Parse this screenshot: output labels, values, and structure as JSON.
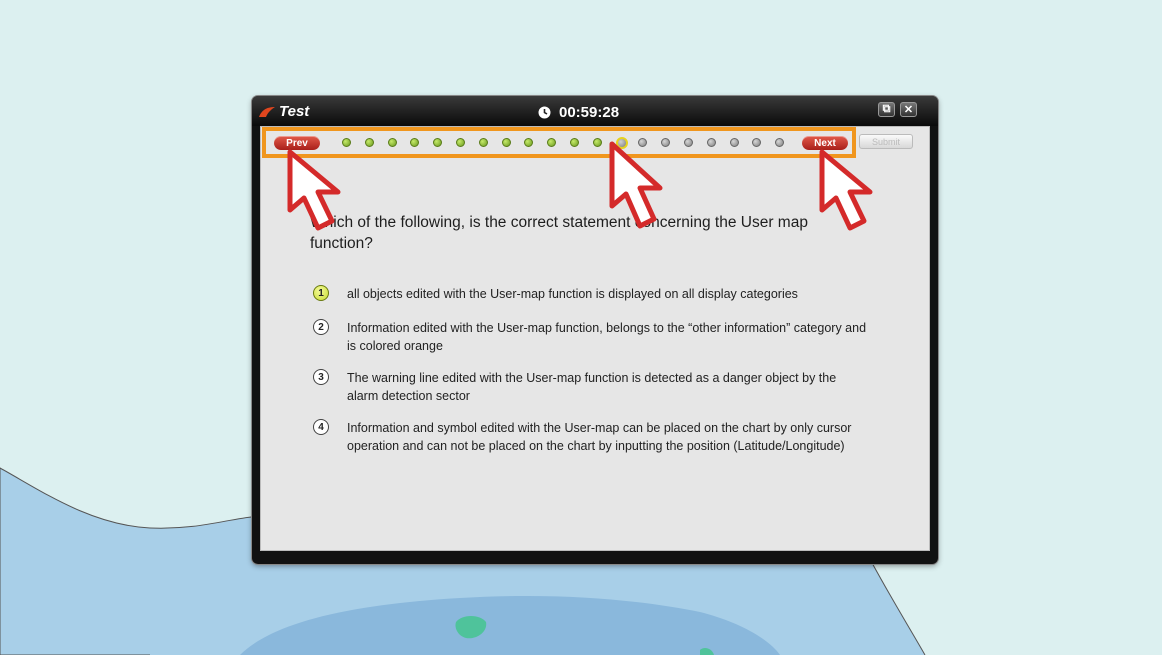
{
  "window": {
    "title": "Test",
    "timer": "00:59:28"
  },
  "nav": {
    "prev_label": "Prev",
    "next_label": "Next",
    "submit_label": "Submit",
    "question_dots": [
      "answered",
      "answered",
      "answered",
      "answered",
      "answered",
      "answered",
      "answered",
      "answered",
      "answered",
      "answered",
      "answered",
      "answered",
      "current",
      "pending",
      "pending",
      "pending",
      "pending",
      "pending",
      "pending",
      "pending"
    ]
  },
  "question": {
    "text": "Which of the following, is the correct statement concerning the User map function?"
  },
  "choices": [
    {
      "num": "1",
      "text": "all objects edited with the User-map function is displayed on all display categories",
      "selected": true
    },
    {
      "num": "2",
      "text": "Information edited with the User-map function, belongs to the “other information” category and is colored orange",
      "selected": false
    },
    {
      "num": "3",
      "text": "The warning line edited with the User-map function is detected as a danger object by the alarm detection sector",
      "selected": false
    },
    {
      "num": "4",
      "text": "Information and symbol edited with the User-map can be placed on the chart by only cursor operation and can not be placed on the chart by inputting the position (Latitude/Longitude)",
      "selected": false
    }
  ],
  "colors": {
    "highlight_border": "#f0961e",
    "pointer_fill": "#ffffff",
    "pointer_outline": "#d42a2a",
    "sea": "#a8cfe8",
    "land": "#dcf0f0"
  }
}
